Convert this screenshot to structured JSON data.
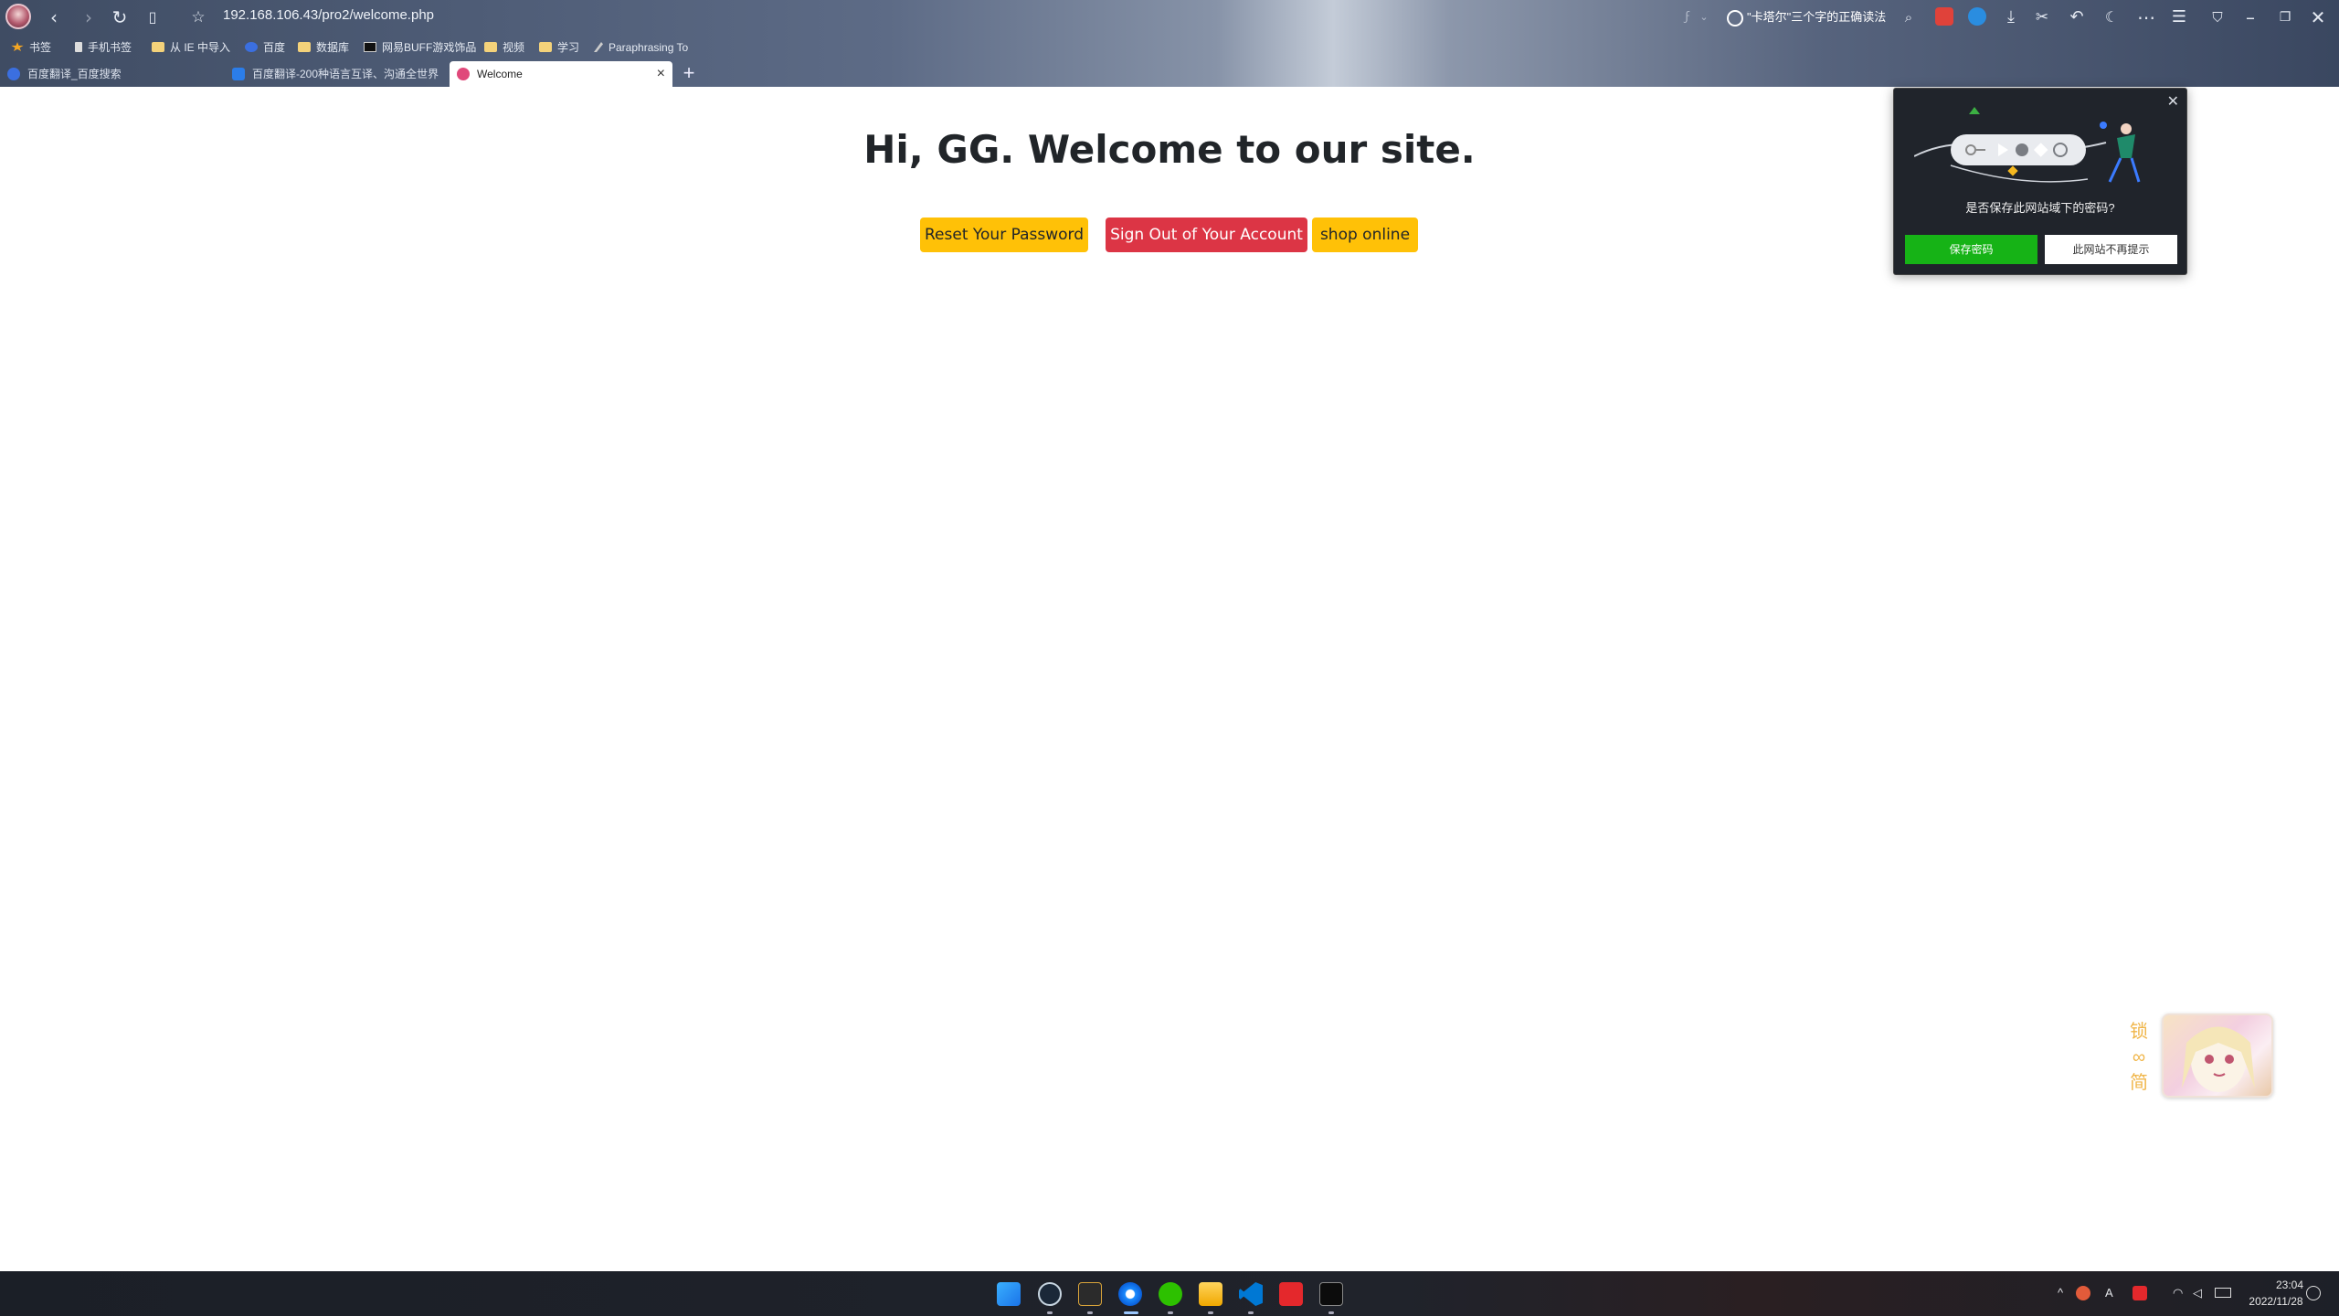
{
  "browser": {
    "url": "192.168.106.43/pro2/welcome.php",
    "search_text": "\"卡塔尔\"三个字的正确读法",
    "bookmarks": [
      {
        "label": "书签"
      },
      {
        "label": "手机书签"
      },
      {
        "label": "从 IE 中导入"
      },
      {
        "label": "百度"
      },
      {
        "label": "数据库"
      },
      {
        "label": "网易BUFF游戏饰品"
      },
      {
        "label": "视频"
      },
      {
        "label": "学习"
      },
      {
        "label": "Paraphrasing To"
      }
    ],
    "tabs": [
      {
        "label": "百度翻译_百度搜索"
      },
      {
        "label": "百度翻译-200种语言互译、沟通全世界"
      },
      {
        "label": "Welcome"
      }
    ]
  },
  "page": {
    "greeting_prefix": "Hi, ",
    "username": "GG",
    "greeting_suffix": ". Welcome to our site.",
    "buttons": {
      "reset_password": "Reset Your Password",
      "sign_out": "Sign Out of Your Account",
      "shop": "shop online"
    }
  },
  "password_popup": {
    "question": "是否保存此网站域下的密码?",
    "save_label": "保存密码",
    "never_label": "此网站不再提示"
  },
  "widget": {
    "chars": [
      "锁",
      "∞",
      "简"
    ]
  },
  "taskbar": {
    "time": "23:04",
    "date": "2022/11/28",
    "ime": "A"
  },
  "colors": {
    "warning": "#ffc107",
    "danger": "#dc3545",
    "save_green": "#16b316"
  }
}
